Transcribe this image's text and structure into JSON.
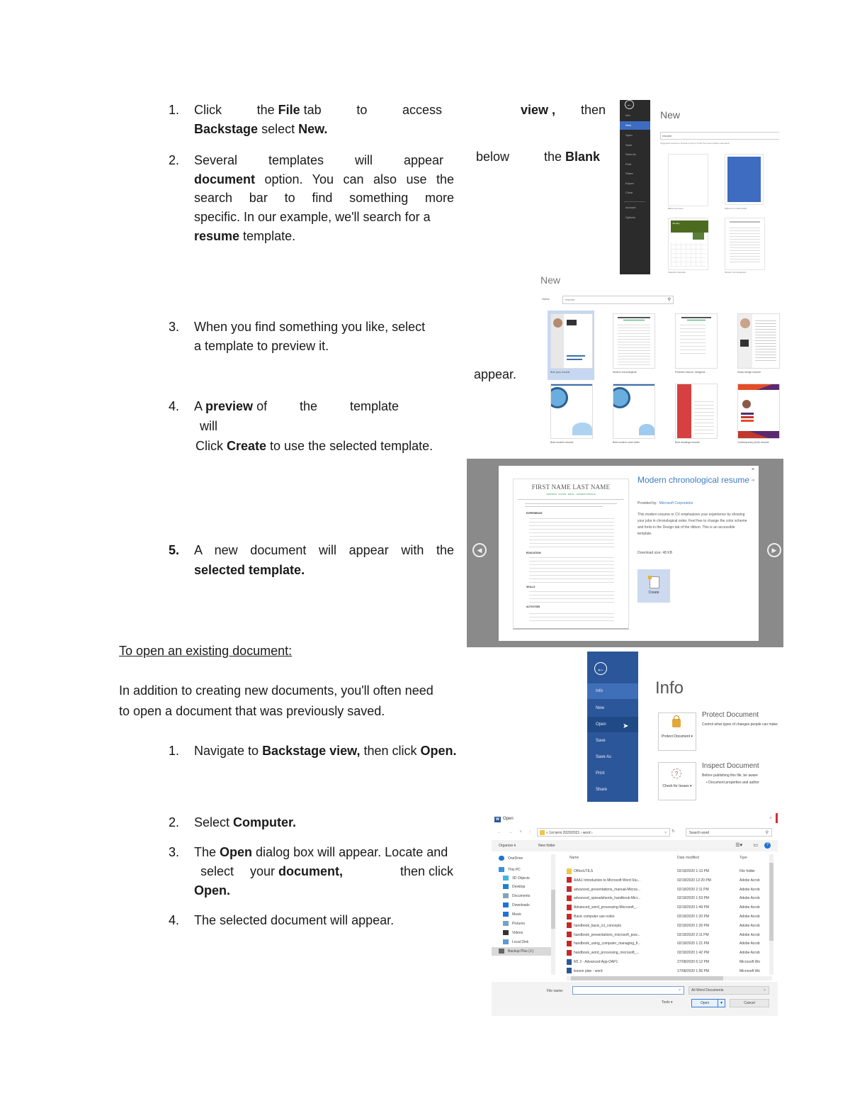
{
  "section_new": {
    "steps": [
      {
        "number": "1.",
        "line1_parts": [
          "Click",
          "the File tab",
          "to",
          "access"
        ],
        "right_parts": [
          "view ,",
          "then"
        ],
        "line2": "Backstage select New."
      },
      {
        "number": "2.",
        "line1_parts": [
          "Several",
          "templates",
          "will",
          "appear"
        ],
        "right_parts": [
          "below",
          "the Blank"
        ],
        "lines": [
          "document option. You can also use the",
          "search bar to find something more",
          "specific. In our example, we'll search for a",
          "resume template."
        ]
      },
      {
        "number": "3.",
        "lines": [
          "When you find something you like, select",
          "a template to preview it."
        ]
      },
      {
        "number": "4.",
        "line1_parts": [
          "A preview of",
          "the",
          "template"
        ],
        "right_word": "appear.",
        "line2": "will",
        "line3": "Click Create to use the selected template."
      },
      {
        "number": "5.",
        "lines": [
          "A new document will appear with the",
          "selected template."
        ]
      }
    ]
  },
  "section_open": {
    "heading": "To open an existing document:",
    "intro_lines": [
      "In addition to creating new documents, you'll often need",
      "to open a document that was previously saved."
    ],
    "steps": [
      {
        "number": "1.",
        "text_pre": "Navigate to ",
        "bold1": "Backstage view,",
        "text_mid": " then click ",
        "bold2": "Open."
      },
      {
        "number": "2.",
        "text_pre": "Select ",
        "bold1": "Computer."
      },
      {
        "number": "3.",
        "line1_pre": "The ",
        "line1_bold": "Open",
        "line1_post": " dialog box will appear. Locate and",
        "line2_a": "select",
        "line2_b": "your",
        "line2_bold": "document,",
        "line2_c": "then click",
        "line3_bold": "Open."
      },
      {
        "number": "4.",
        "text": "The selected document will appear."
      }
    ]
  },
  "screenshot_new": {
    "back_icon": "arrow-left-circle",
    "menu": [
      "Info",
      "New",
      "Open",
      "Save",
      "Save As",
      "Print",
      "Share",
      "Export",
      "Close",
      "Account",
      "Options"
    ],
    "selected": "New",
    "title": "New",
    "search_value": "resume",
    "suggested": "Suggested searches:  Business  Flyers  Cards  Personal  Holidays  Education",
    "tiles": [
      {
        "caption": "Blank document"
      },
      {
        "caption": "Welcome to Word 2016"
      },
      {
        "caption": "Snapshot calendar",
        "banner": "January"
      },
      {
        "caption": "Modern chronological r..."
      }
    ]
  },
  "screenshot_templates": {
    "title": "New",
    "search_label": "Home",
    "search_value": "resume",
    "cards": [
      {
        "label": "Blue grey resume",
        "selected": true
      },
      {
        "label": "Modern chronological",
        "selected": false
      },
      {
        "label": "Polished resume, designed...",
        "selected": false
      },
      {
        "label": "Swiss design resume",
        "selected": false
      },
      {
        "label": "Bold modern resume",
        "selected": false
      },
      {
        "label": "Bold modern cover letter",
        "selected": false
      },
      {
        "label": "Bold headings resume",
        "selected": false
      },
      {
        "label": "Contemporary photo resume",
        "selected": false
      }
    ]
  },
  "screenshot_preview": {
    "doc_name": "FIRST NAME LAST NAME",
    "doc_subtitle": "ADDRESS · PHONE · EMAIL · LINKEDIN PROFILE",
    "doc_sections": [
      "EXPERIENCE",
      "EDUCATION",
      "SKILLS",
      "ACTIVITIES"
    ],
    "title": "Modern chronological resume",
    "provided_by_label": "Provided by:",
    "provided_by": "Microsoft Corporation",
    "description": "This modern resume or CV emphasizes your experience by showing your jobs in chronological order. Feel free to change the color scheme and fonts in the Design tab of the ribbon. This is an accessible template.",
    "download_size": "Download size:  48 KB",
    "create_label": "Create",
    "close_icon": "×",
    "pin_icon": "⇥",
    "prev_icon": "◀",
    "next_icon": "▶"
  },
  "screenshot_info": {
    "menu": [
      "Info",
      "New",
      "Open",
      "Save",
      "Save As",
      "Print",
      "Share"
    ],
    "selected": "Info",
    "hovered": "Open",
    "title": "Info",
    "protect_button": "Protect Document ▾",
    "protect_title": "Protect Document",
    "protect_desc": "Control what types of changes people can make",
    "inspect_button": "Check for Issues ▾",
    "inspect_title": "Inspect Document",
    "inspect_desc": "Before publishing this file, be aware",
    "inspect_bullet": "Document properties and author"
  },
  "screenshot_open_dialog": {
    "title": "Open",
    "close_icon": "×",
    "address": "« 1st term 2020/2021  ›  word  ›",
    "search_placeholder": "Search word",
    "organize": "Organize ▾",
    "new_folder": "New folder",
    "nav_items": [
      {
        "label": "OneDrive",
        "icon": "cloud",
        "color": "#1e73d6"
      },
      {
        "label": "This PC",
        "icon": "pc",
        "color": "#3b8fd9"
      },
      {
        "label": "3D Objects",
        "icon": "cube",
        "color": "#3fb4e6"
      },
      {
        "label": "Desktop",
        "icon": "desktop",
        "color": "#1e7fd6"
      },
      {
        "label": "Documents",
        "icon": "docs",
        "color": "#8aa0b8"
      },
      {
        "label": "Downloads",
        "icon": "download",
        "color": "#1e73d6"
      },
      {
        "label": "Music",
        "icon": "music",
        "color": "#1e73d6"
      },
      {
        "label": "Pictures",
        "icon": "pictures",
        "color": "#7aa0c8"
      },
      {
        "label": "Videos",
        "icon": "videos",
        "color": "#333"
      },
      {
        "label": "Local Disk",
        "icon": "disk",
        "color": "#5c9ad6"
      },
      {
        "label": "Backup Plus (J:)",
        "icon": "drive",
        "color": "#666",
        "selected": true
      }
    ],
    "columns": [
      "Name",
      "Date modified",
      "Type"
    ],
    "files": [
      {
        "name": "OfficeUTILS",
        "date": "02/18/2020 1:13 PM",
        "type": "File folder",
        "kind": "folder"
      },
      {
        "name": "AAA1 Introduction to Microsoft Word Stu...",
        "date": "02/18/2020 12:20 PM",
        "type": "Adobe Acrob",
        "kind": "pdf"
      },
      {
        "name": "advanced_presentations_manual-Micros...",
        "date": "02/18/2020 2:11 PM",
        "type": "Adobe Acrob",
        "kind": "pdf"
      },
      {
        "name": "advanced_spreadsheets_handbook-Micr...",
        "date": "02/18/2020 1:53 PM",
        "type": "Adobe Acrob",
        "kind": "pdf"
      },
      {
        "name": "Advanced_word_processing-Microsoft_...",
        "date": "02/18/2020 1:49 PM",
        "type": "Adobe Acrob",
        "kind": "pdf"
      },
      {
        "name": "Basic computer use notes",
        "date": "02/18/2020 1:20 PM",
        "type": "Adobe Acrob",
        "kind": "pdf"
      },
      {
        "name": "handbook_basic_ict_concepts",
        "date": "02/18/2020 1:26 PM",
        "type": "Adobe Acrob",
        "kind": "pdf"
      },
      {
        "name": "handbook_presentations_microsoft_pow...",
        "date": "02/18/2020 2:11 PM",
        "type": "Adobe Acrob",
        "kind": "pdf"
      },
      {
        "name": "handbook_using_computer_managing_fi...",
        "date": "02/18/2020 1:21 PM",
        "type": "Adobe Acrob",
        "kind": "pdf"
      },
      {
        "name": "handbook_word_processing_microsoft_...",
        "date": "02/18/2020 1:42 PM",
        "type": "Adobe Acrob",
        "kind": "pdf"
      },
      {
        "name": "M1 2 - Advanced App-DAP1",
        "date": "27/08/2020 6:12 PM",
        "type": "Microsoft Wo",
        "kind": "word"
      },
      {
        "name": "lesson plan - word",
        "date": "17/08/2020 1:56 PM",
        "type": "Microsoft Wo",
        "kind": "word"
      }
    ],
    "file_name_label": "File name:",
    "file_name_value": "",
    "file_type": "All Word Documents",
    "tools": "Tools ▾",
    "open_button": "Open",
    "cancel_button": "Cancel"
  }
}
